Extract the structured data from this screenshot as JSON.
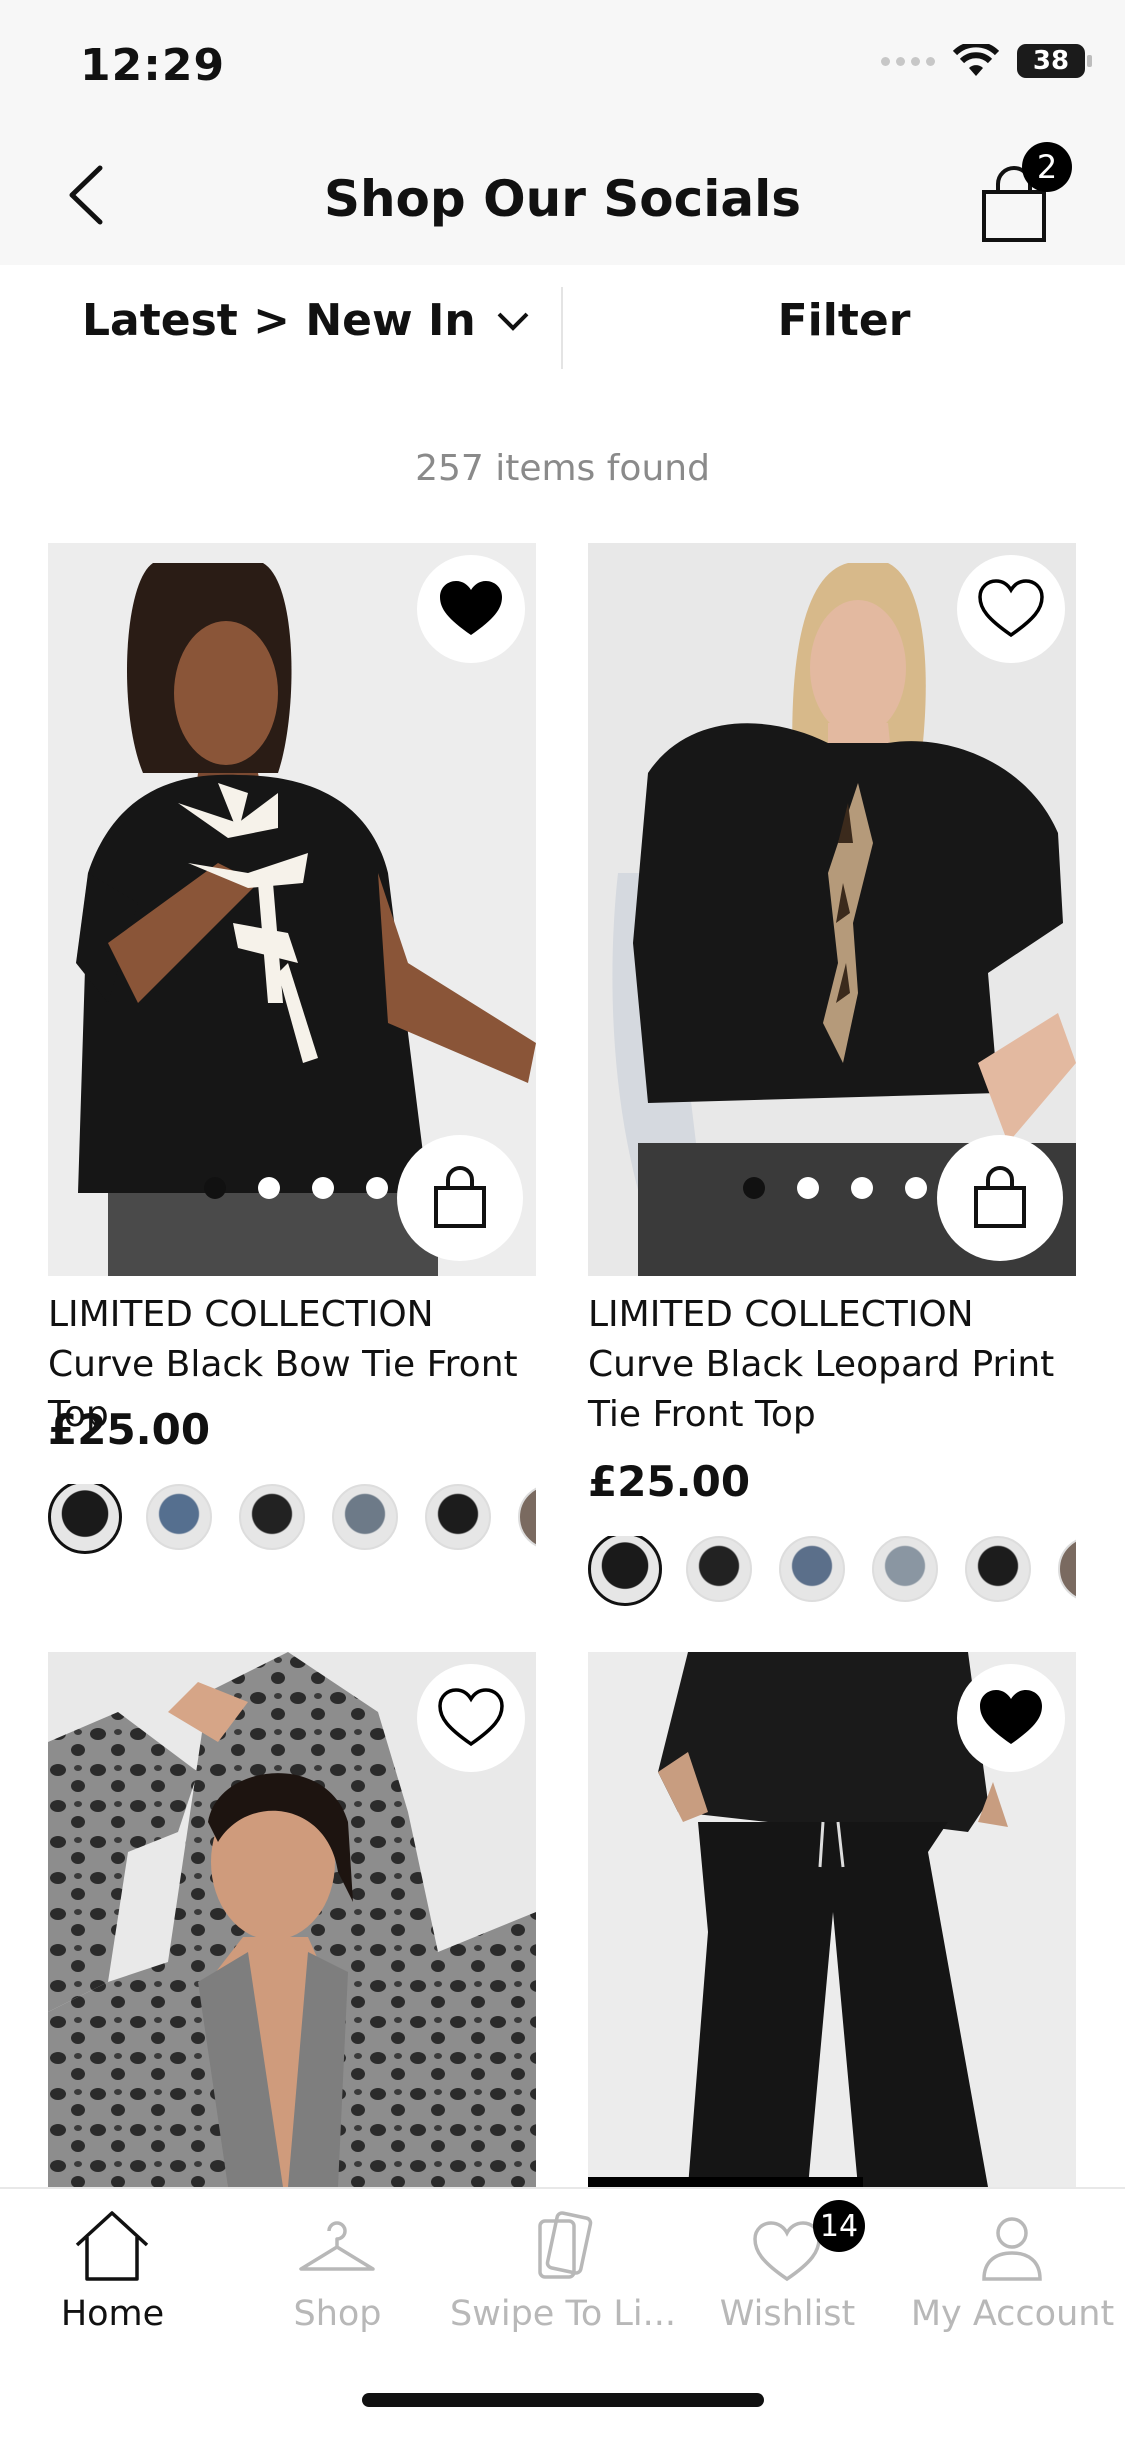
{
  "status": {
    "time": "12:29",
    "battery": "38"
  },
  "header": {
    "title": "Shop Our Socials",
    "cart_count": "2"
  },
  "sort": {
    "label": "Latest > New In",
    "filter_label": "Filter"
  },
  "results": {
    "count_text": "257 items found"
  },
  "products": [
    {
      "title": "LIMITED COLLECTION Curve Black Bow Tie Front Top",
      "price": "£25.00",
      "wishlisted": true
    },
    {
      "title": "LIMITED COLLECTION Curve Black Leopard Print Tie Front Top",
      "price": "£25.00",
      "wishlisted": false
    },
    {
      "wishlisted": false
    },
    {
      "wishlisted": true
    }
  ],
  "tabs": [
    {
      "label": "Home",
      "icon": "home-icon",
      "active": true
    },
    {
      "label": "Shop",
      "icon": "hanger-icon"
    },
    {
      "label": "Swipe To Li...",
      "icon": "swipe-cards-icon"
    },
    {
      "label": "Wishlist",
      "icon": "heart-icon",
      "badge": "14"
    },
    {
      "label": "My Account",
      "icon": "account-icon"
    }
  ]
}
